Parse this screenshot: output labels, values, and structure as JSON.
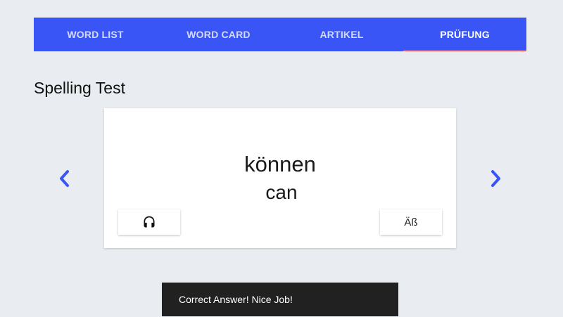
{
  "tabs": [
    {
      "label": "WORD LIST",
      "active": false
    },
    {
      "label": "WORD CARD",
      "active": false
    },
    {
      "label": "ARTIKEL",
      "active": false
    },
    {
      "label": "PRÜFUNG",
      "active": true
    }
  ],
  "section": {
    "title": "Spelling Test"
  },
  "card": {
    "word": "können",
    "translation": "can",
    "audio_icon": "headphones-icon",
    "special_chars_label": "Äß"
  },
  "nav": {
    "prev_icon": "chevron-left-icon",
    "next_icon": "chevron-right-icon"
  },
  "snackbar": {
    "message": "Correct Answer! Nice Job!"
  },
  "colors": {
    "tabbar_bg": "#3a55f5",
    "tab_indicator": "#f0544a",
    "arrow": "#3a55f5",
    "page_bg": "#e9ecf0",
    "snackbar_bg": "#212121"
  }
}
